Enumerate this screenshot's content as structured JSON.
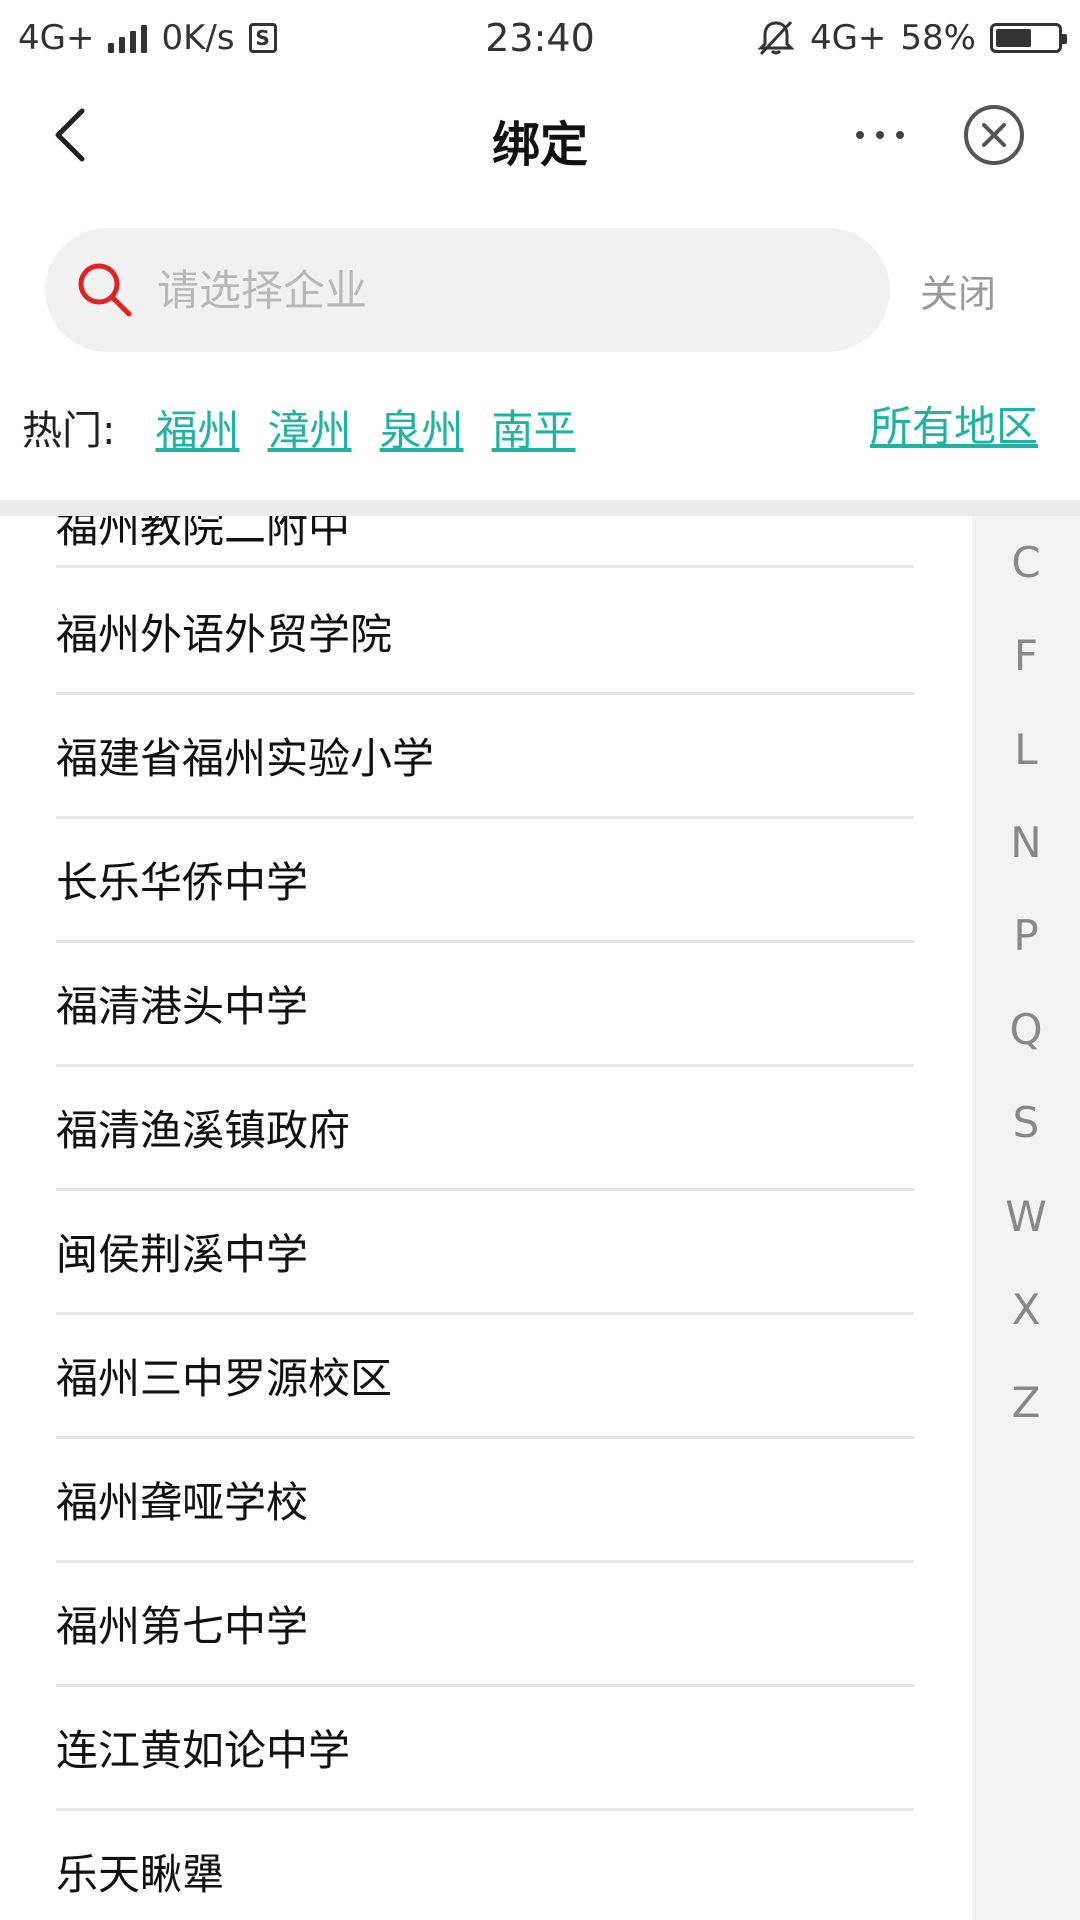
{
  "status_bar": {
    "network_left": "4G+",
    "speed": "0K/s",
    "sim_icon_text": "S",
    "time": "23:40",
    "network_right": "4G+",
    "battery": "58%",
    "icons": [
      "signal-icon",
      "silent-bell-icon",
      "battery-icon"
    ]
  },
  "header": {
    "title": "绑定",
    "back_icon": "chevron-left-icon",
    "more_icon": "more-dots-icon",
    "close_icon": "close-circle-icon"
  },
  "search": {
    "placeholder": "请选择企业",
    "value": "",
    "close_label": "关闭",
    "icon_color": "#e02424"
  },
  "hot": {
    "label": "热门:",
    "cities": [
      "福州",
      "漳州",
      "泉州",
      "南平"
    ],
    "all_regions": "所有地区",
    "link_color": "#1fb3a0"
  },
  "list": {
    "items": [
      "福州教院二附中",
      "福州外语外贸学院",
      "福建省福州实验小学",
      "长乐华侨中学",
      "福清港头中学",
      "福清渔溪镇政府",
      "闽侯荆溪中学",
      "福州三中罗源校区",
      "福州聋哑学校",
      "福州第七中学",
      "连江黄如论中学",
      "乐天瞅犟"
    ]
  },
  "index_bar": {
    "letters": [
      "C",
      "F",
      "L",
      "N",
      "P",
      "Q",
      "S",
      "W",
      "X",
      "Z"
    ]
  }
}
